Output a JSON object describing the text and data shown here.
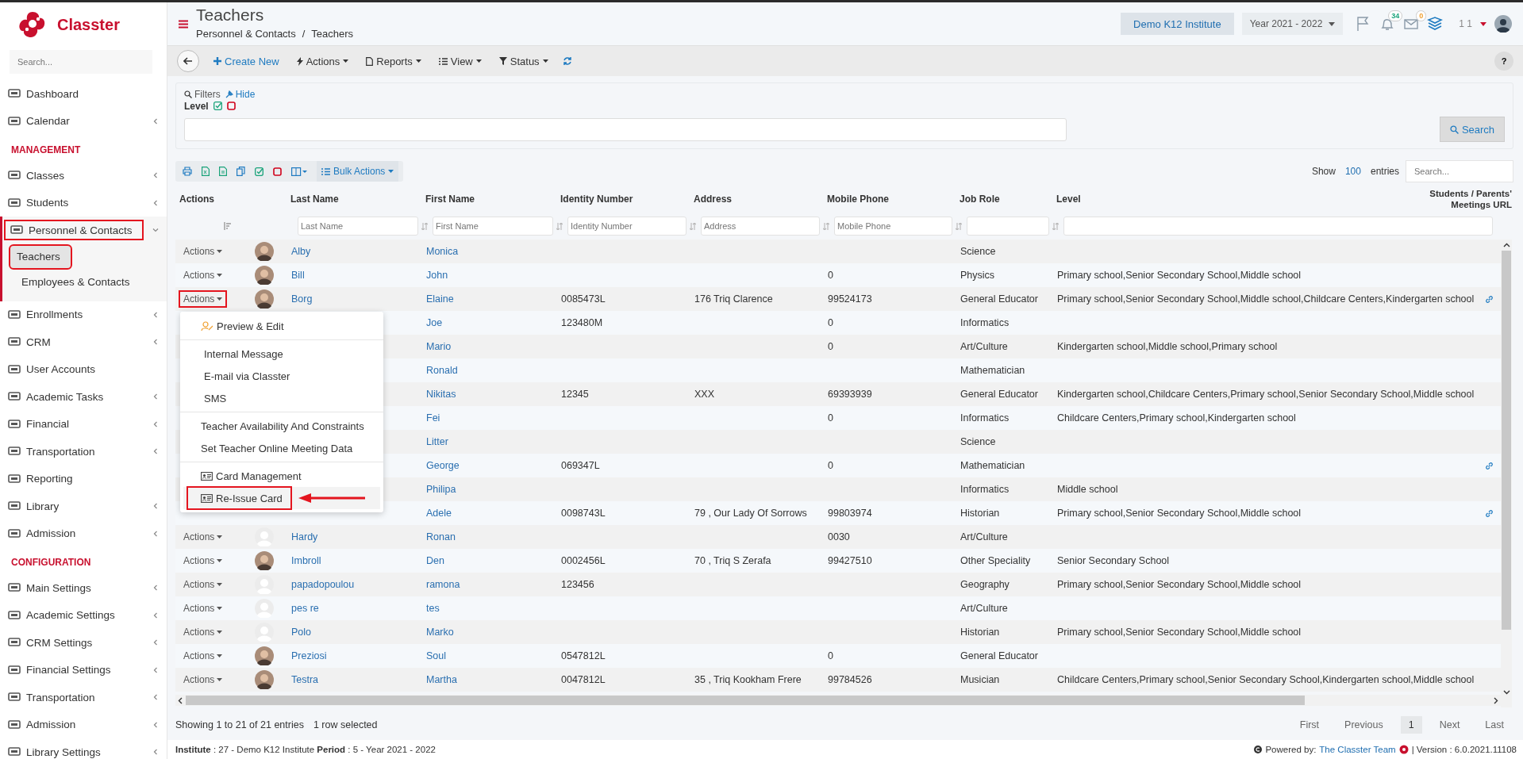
{
  "brand": {
    "name": "Classter"
  },
  "sidebar": {
    "search_placeholder": "Search...",
    "items": [
      {
        "kind": "item",
        "label": "Dashboard",
        "expandable": false
      },
      {
        "kind": "item",
        "label": "Calendar",
        "expandable": true
      },
      {
        "kind": "section",
        "label": "MANAGEMENT"
      },
      {
        "kind": "item",
        "label": "Classes",
        "expandable": true
      },
      {
        "kind": "item",
        "label": "Students",
        "expandable": true
      },
      {
        "kind": "item",
        "label": "Personnel & Contacts",
        "expandable": true,
        "expanded": true,
        "highlighted": true,
        "children": [
          {
            "label": "Teachers",
            "selected": true,
            "highlighted": true
          },
          {
            "label": "Employees & Contacts",
            "selected": false,
            "highlighted": false
          }
        ]
      },
      {
        "kind": "item",
        "label": "Enrollments",
        "expandable": true
      },
      {
        "kind": "item",
        "label": "CRM",
        "expandable": true
      },
      {
        "kind": "item",
        "label": "User Accounts",
        "expandable": false
      },
      {
        "kind": "item",
        "label": "Academic Tasks",
        "expandable": true
      },
      {
        "kind": "item",
        "label": "Financial",
        "expandable": true
      },
      {
        "kind": "item",
        "label": "Transportation",
        "expandable": true
      },
      {
        "kind": "item",
        "label": "Reporting",
        "expandable": false
      },
      {
        "kind": "item",
        "label": "Library",
        "expandable": true
      },
      {
        "kind": "item",
        "label": "Admission",
        "expandable": true
      },
      {
        "kind": "section",
        "label": "CONFIGURATION"
      },
      {
        "kind": "item",
        "label": "Main Settings",
        "expandable": true
      },
      {
        "kind": "item",
        "label": "Academic Settings",
        "expandable": true
      },
      {
        "kind": "item",
        "label": "CRM Settings",
        "expandable": true
      },
      {
        "kind": "item",
        "label": "Financial Settings",
        "expandable": true
      },
      {
        "kind": "item",
        "label": "Transportation",
        "expandable": true
      },
      {
        "kind": "item",
        "label": "Admission",
        "expandable": true
      },
      {
        "kind": "item",
        "label": "Library Settings",
        "expandable": true
      }
    ]
  },
  "header": {
    "title": "Teachers",
    "breadcrumb": [
      "Personnel & Contacts",
      "Teachers"
    ],
    "breadcrumb_separator": "/",
    "institute": "Demo K12 Institute",
    "year": "Year 2021 - 2022",
    "notifications": "34",
    "messages": "0",
    "user": "1 1"
  },
  "toolbar": [
    {
      "kind": "create",
      "label": "Create New"
    },
    {
      "kind": "actions",
      "label": "Actions"
    },
    {
      "kind": "reports",
      "label": "Reports"
    },
    {
      "kind": "view",
      "label": "View"
    },
    {
      "kind": "status",
      "label": "Status"
    }
  ],
  "help": "?",
  "filters": {
    "title": "Filters",
    "hide": "Hide",
    "level_label": "Level",
    "search_button": "Search"
  },
  "table_tools": {
    "bulk": "Bulk Actions",
    "show": "Show",
    "entries_count": "100",
    "entries": "entries",
    "search_placeholder": "Search..."
  },
  "table": {
    "columns": [
      "Actions",
      "Last Name",
      "First Name",
      "Identity Number",
      "Address",
      "Mobile Phone",
      "Job Role",
      "Level",
      "Students / Parents' Meetings URL"
    ],
    "filter_placeholders": [
      "Last Name",
      "First Name",
      "Identity Number",
      "Address",
      "Mobile Phone"
    ],
    "rows": [
      {
        "actions": "Actions",
        "has_photo": true,
        "last_name": "Alby",
        "first_name": "Monica",
        "identity": "",
        "address": "",
        "phone": "",
        "job": "Science",
        "level": "",
        "url_link": false
      },
      {
        "actions": "Actions",
        "has_photo": true,
        "last_name": "Bill",
        "first_name": "John",
        "identity": "",
        "address": "",
        "phone": "0",
        "job": "Physics",
        "level": "Primary school,Senior Secondary School,Middle school",
        "url_link": false
      },
      {
        "actions": "Actions",
        "has_photo": true,
        "last_name": "Borg",
        "first_name": "Elaine",
        "identity": "0085473L",
        "address": "176 Triq Clarence",
        "phone": "99524173",
        "job": "General Educator",
        "level": "Primary school,Senior Secondary School,Middle school,Childcare Centers,Kindergarten school",
        "url_link": true,
        "highlighted": true
      },
      {
        "first_name": "Joe",
        "identity": "123480M",
        "address": "",
        "phone": "0",
        "job": "Informatics",
        "level": "",
        "url_link": false
      },
      {
        "first_name": "Mario",
        "identity": "",
        "address": "",
        "phone": "0",
        "job": "Art/Culture",
        "level": "Kindergarten school,Middle school,Primary school",
        "url_link": false
      },
      {
        "first_name": "Ronald",
        "identity": "",
        "address": "",
        "phone": "",
        "job": "Mathematician",
        "level": "",
        "url_link": false
      },
      {
        "first_name": "Nikitas",
        "identity": "12345",
        "address": "XXX",
        "phone": "69393939",
        "job": "General Educator",
        "level": "Kindergarten school,Childcare Centers,Primary school,Senior Secondary School,Middle school",
        "url_link": false
      },
      {
        "first_name": "Fei",
        "identity": "",
        "address": "",
        "phone": "0",
        "job": "Informatics",
        "level": "Childcare Centers,Primary school,Kindergarten school",
        "url_link": false
      },
      {
        "first_name": "Litter",
        "identity": "",
        "address": "",
        "phone": "",
        "job": "Science",
        "level": "",
        "url_link": false
      },
      {
        "first_name": "George",
        "identity": "069347L",
        "address": "",
        "phone": "0",
        "job": "Mathematician",
        "level": "",
        "url_link": true
      },
      {
        "first_name": "Philipa",
        "identity": "",
        "address": "",
        "phone": "",
        "job": "Informatics",
        "level": "Middle school",
        "url_link": false
      },
      {
        "first_name": "Adele",
        "identity": "0098743L",
        "address": "79 , Our Lady Of Sorrows",
        "phone": "99803974",
        "job": "Historian",
        "level": "Primary school,Senior Secondary School,Middle school",
        "url_link": true
      },
      {
        "actions": "Actions",
        "has_photo": false,
        "last_name": "Hardy",
        "first_name": "Ronan",
        "identity": "",
        "address": "",
        "phone": "0030",
        "job": "Art/Culture",
        "level": "",
        "url_link": false
      },
      {
        "actions": "Actions",
        "has_photo": true,
        "last_name": "Imbroll",
        "first_name": "Den",
        "identity": "0002456L",
        "address": "70 , Triq S Zerafa",
        "phone": "99427510",
        "job": "Other Speciality",
        "level": "Senior Secondary School",
        "url_link": false
      },
      {
        "actions": "Actions",
        "has_photo": false,
        "last_name": "papadopoulou",
        "first_name": "ramona",
        "identity": "123456",
        "address": "",
        "phone": "",
        "job": "Geography",
        "level": "Primary school,Senior Secondary School,Middle school",
        "url_link": false
      },
      {
        "actions": "Actions",
        "has_photo": false,
        "last_name": "pes re",
        "first_name": "tes",
        "identity": "",
        "address": "",
        "phone": "",
        "job": "Art/Culture",
        "level": "",
        "url_link": false
      },
      {
        "actions": "Actions",
        "has_photo": false,
        "last_name": "Polo",
        "first_name": "Marko",
        "identity": "",
        "address": "",
        "phone": "",
        "job": "Historian",
        "level": "Primary school,Senior Secondary School,Middle school",
        "url_link": false
      },
      {
        "actions": "Actions",
        "has_photo": true,
        "last_name": "Preziosi",
        "first_name": "Soul",
        "identity": "0547812L",
        "address": "",
        "phone": "0",
        "job": "General Educator",
        "level": "",
        "url_link": false
      },
      {
        "actions": "Actions",
        "has_photo": true,
        "last_name": "Testra",
        "first_name": "Martha",
        "identity": "0047812L",
        "address": "35 , Triq Kookham Frere",
        "phone": "99784526",
        "job": "Musician",
        "level": "Childcare Centers,Primary school,Senior Secondary School,Kindergarten school,Middle school",
        "url_link": false
      }
    ]
  },
  "row_menu": [
    [
      {
        "kind": "edit",
        "label": "Preview & Edit",
        "highlighted": false
      }
    ],
    [
      {
        "kind": "plain",
        "label": "Internal Message",
        "highlighted": false
      },
      {
        "kind": "plain",
        "label": "E-mail via Classter",
        "highlighted": false
      },
      {
        "kind": "plain",
        "label": "SMS",
        "highlighted": false
      }
    ],
    [
      {
        "kind": "text",
        "label": "Teacher Availability And Constraints",
        "highlighted": false
      },
      {
        "kind": "text",
        "label": "Set Teacher Online Meeting Data",
        "highlighted": false
      }
    ],
    [
      {
        "kind": "card",
        "label": "Card Management",
        "highlighted": false
      },
      {
        "kind": "card",
        "label": "Re-Issue Card",
        "highlighted": true
      }
    ]
  ],
  "summary": "Showing 1 to 21 of 21 entries",
  "selection": "1 row selected",
  "pagination": [
    {
      "label": "First",
      "selected": false
    },
    {
      "label": "Previous",
      "selected": false
    },
    {
      "label": "1",
      "selected": true
    },
    {
      "label": "Next",
      "selected": false
    },
    {
      "label": "Last",
      "selected": false
    }
  ],
  "footer": {
    "info": "**Institute** : 27 - Demo K12 Institute **Period** : 5 - Year 2021 - 2022",
    "powered": "Powered by:",
    "team": "The Classter Team",
    "version": "| Version : 6.0.2021.11108"
  }
}
